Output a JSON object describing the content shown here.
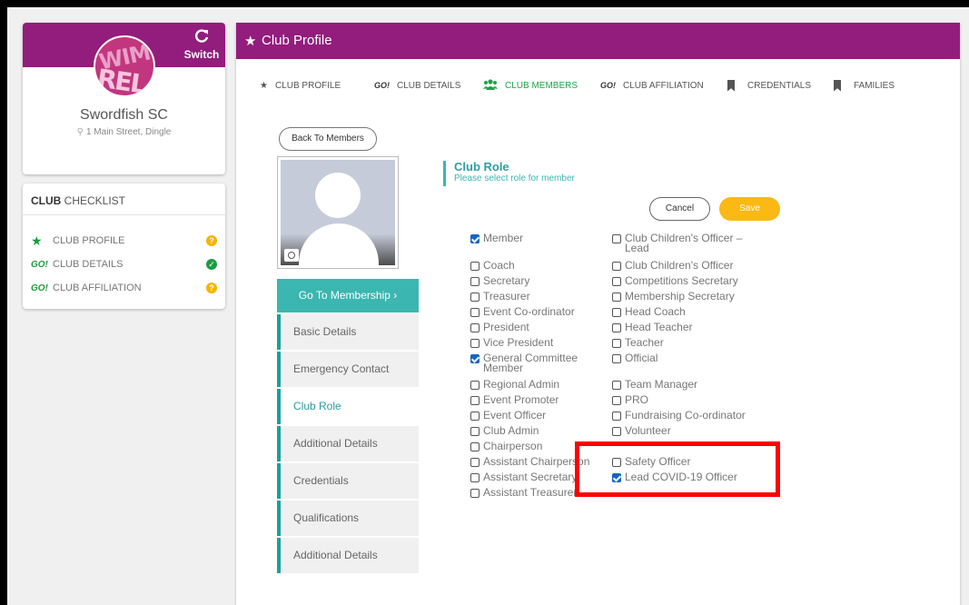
{
  "club": {
    "switch_label": "Switch",
    "logo_text_top": "WIM",
    "logo_text_bottom": "REL",
    "name": "Swordfish SC",
    "address": "1 Main Street, Dingle"
  },
  "checklist": {
    "title_bold": "CLUB",
    "title_rest": " CHECKLIST",
    "items": [
      {
        "icon": "star-icon",
        "label": "CLUB PROFILE",
        "status": "warning"
      },
      {
        "icon": "go-icon",
        "icon_text": "GO!",
        "label": "CLUB DETAILS",
        "status": "complete"
      },
      {
        "icon": "go-icon",
        "icon_text": "GO!",
        "label": "CLUB AFFILIATION",
        "status": "warning"
      }
    ]
  },
  "header": {
    "title": "Club Profile"
  },
  "tabs": [
    {
      "icon": "star-icon",
      "label": "CLUB PROFILE",
      "active": false
    },
    {
      "icon": "go-icon",
      "icon_text": "GO!",
      "label": "CLUB DETAILS",
      "active": false
    },
    {
      "icon": "people-icon",
      "label": "CLUB MEMBERS",
      "active": true
    },
    {
      "icon": "go-icon",
      "icon_text": "GO!",
      "label": "CLUB AFFILIATION",
      "active": false
    },
    {
      "icon": "bookmark-icon",
      "label": "CREDENTIALS",
      "active": false
    },
    {
      "icon": "bookmark-icon",
      "label": "FAMILIES",
      "active": false
    }
  ],
  "back_label": "Back To Members",
  "go_membership_label": "Go To Membership ›",
  "side_menu": [
    {
      "label": "Basic Details",
      "active": false
    },
    {
      "label": "Emergency Contact",
      "active": false
    },
    {
      "label": "Club Role",
      "active": true
    },
    {
      "label": "Additional Details",
      "active": false
    },
    {
      "label": "Credentials",
      "active": false
    },
    {
      "label": "Qualifications",
      "active": false
    },
    {
      "label": "Additional Details",
      "active": false
    }
  ],
  "role_section": {
    "title": "Club Role",
    "subtitle": "Please select role for member",
    "cancel_label": "Cancel",
    "save_label": "Save"
  },
  "roles_left": [
    {
      "label": "Member",
      "checked": true
    },
    {
      "label": "Coach",
      "checked": false
    },
    {
      "label": "Secretary",
      "checked": false
    },
    {
      "label": "Treasurer",
      "checked": false
    },
    {
      "label": "Event Co-ordinator",
      "checked": false
    },
    {
      "label": "President",
      "checked": false
    },
    {
      "label": "Vice President",
      "checked": false
    },
    {
      "label": "General Committee Member",
      "checked": true
    },
    {
      "label": "Regional Admin",
      "checked": false
    },
    {
      "label": "Event Promoter",
      "checked": false
    },
    {
      "label": "Event Officer",
      "checked": false
    },
    {
      "label": "Club Admin",
      "checked": false
    },
    {
      "label": "Chairperson",
      "checked": false
    },
    {
      "label": "Assistant Chairperson",
      "checked": false
    },
    {
      "label": "Assistant Secretary",
      "checked": false
    },
    {
      "label": "Assistant Treasurer",
      "checked": false
    }
  ],
  "roles_right": [
    {
      "label": "Club Children's Officer – Lead",
      "checked": false
    },
    {
      "label": "Club Children's Officer",
      "checked": false
    },
    {
      "label": "Competitions Secretary",
      "checked": false
    },
    {
      "label": "Membership Secretary",
      "checked": false
    },
    {
      "label": "Head Coach",
      "checked": false
    },
    {
      "label": "Head Teacher",
      "checked": false
    },
    {
      "label": "Teacher",
      "checked": false
    },
    {
      "label": "Official",
      "checked": false
    },
    {
      "label": "Team Manager",
      "checked": false
    },
    {
      "label": "PRO",
      "checked": false
    },
    {
      "label": "Fundraising Co-ordinator",
      "checked": false
    },
    {
      "label": "Volunteer",
      "checked": false
    },
    {
      "label": "Safety Officer",
      "checked": false
    },
    {
      "label": "Lead COVID-19 Officer",
      "checked": true
    }
  ],
  "colors": {
    "brand": "#921d7c",
    "teal": "#3cb6b0",
    "save": "#fcb814",
    "highlight": "#ff0000"
  }
}
